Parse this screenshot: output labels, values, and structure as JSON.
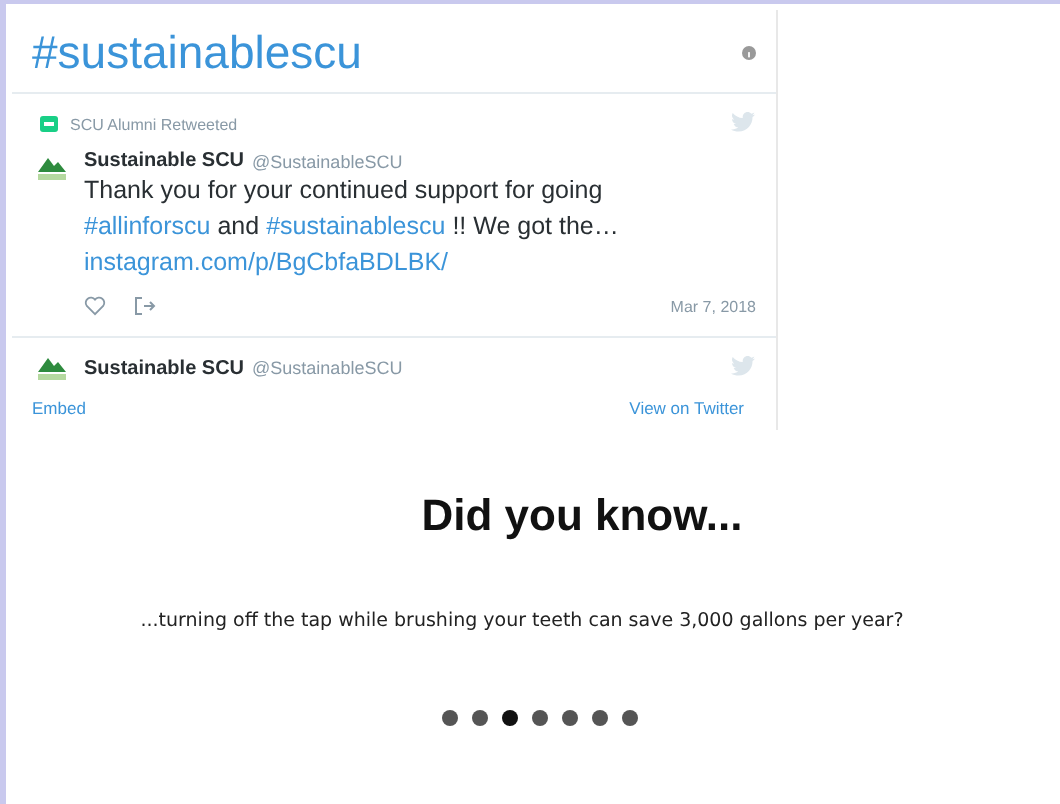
{
  "timeline": {
    "title": "#sustainablescu",
    "tweets": [
      {
        "retweeted_by": "SCU Alumni Retweeted",
        "name": "Sustainable SCU",
        "handle": "@SustainableSCU",
        "text": "Thank you for your continued support for going",
        "tags": [
          "#allinforscu",
          "and",
          "#sustainablescu",
          "!! We got the…"
        ],
        "link": "instagram.com/p/BgCbfaBDLBK/",
        "date": "Mar 7, 2018"
      },
      {
        "name": "Sustainable SCU",
        "handle": "@SustainableSCU"
      }
    ],
    "embed": "Embed",
    "view": "View on Twitter"
  },
  "fact": {
    "heading": "Did you know...",
    "text": "...turning off the tap while brushing your teeth can save 3,000 gallons per year?"
  },
  "dots": [
    {
      "selected": false
    },
    {
      "selected": false
    },
    {
      "selected": true
    },
    {
      "selected": false
    },
    {
      "selected": false
    },
    {
      "selected": false
    },
    {
      "selected": false
    }
  ]
}
